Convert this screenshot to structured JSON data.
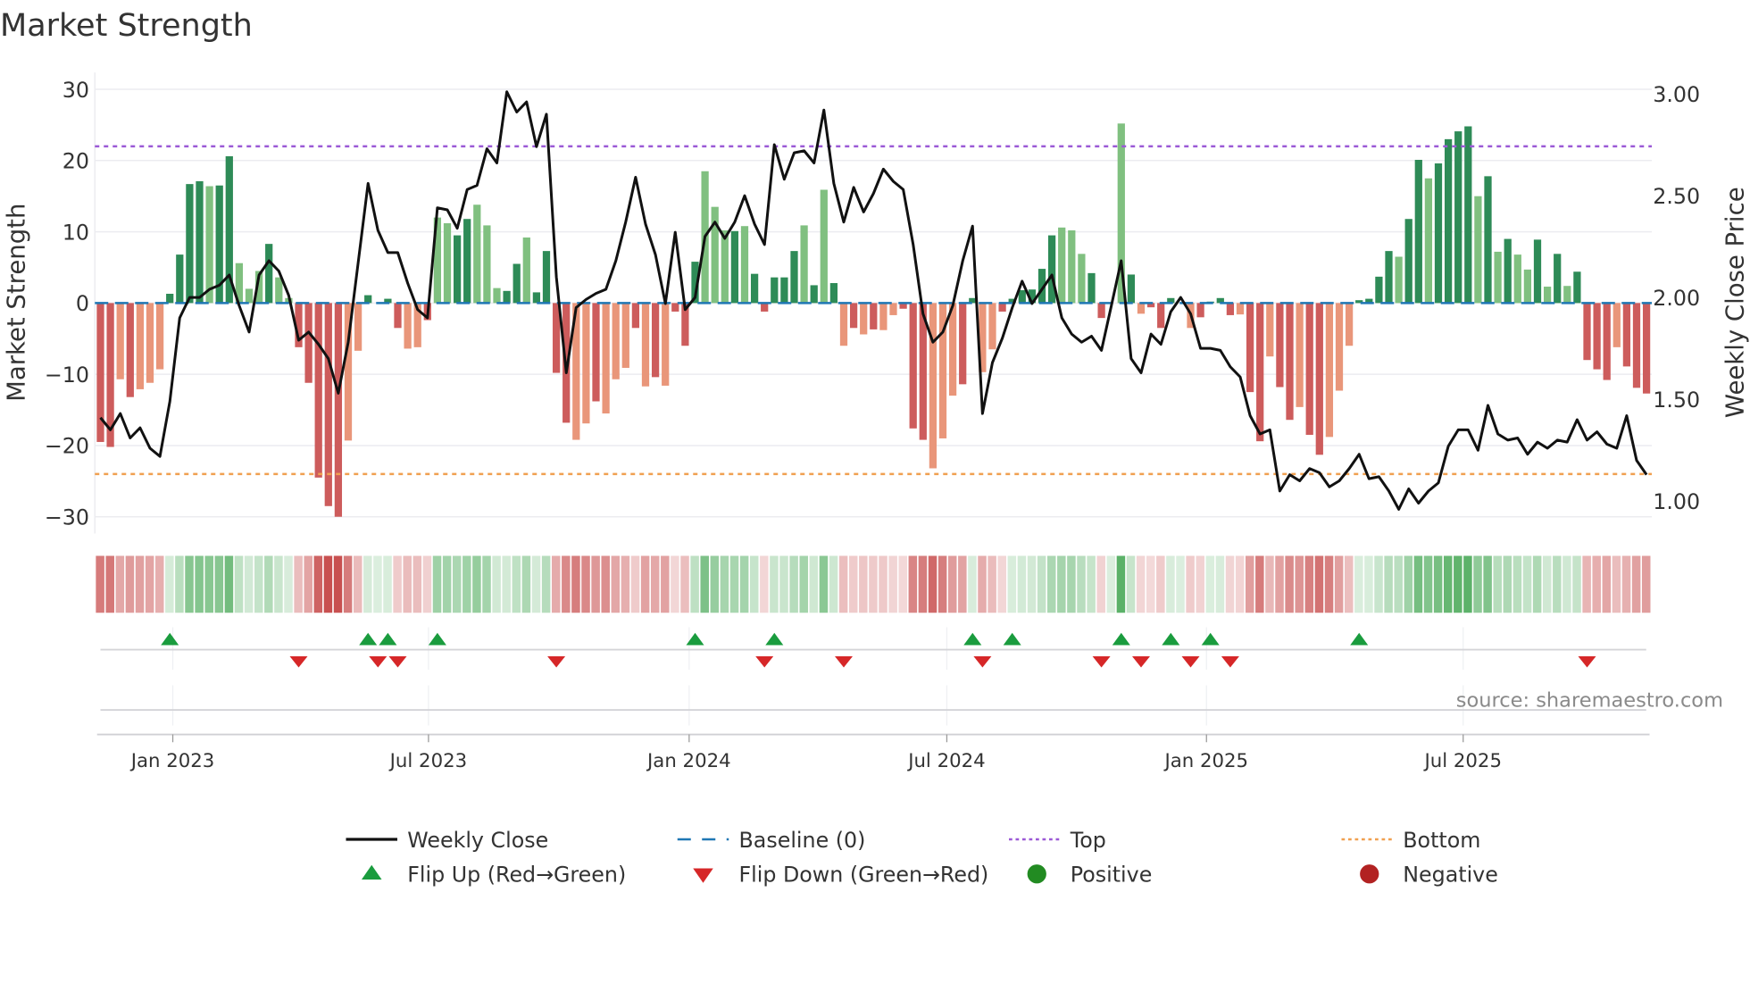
{
  "chart_data": {
    "type": "bar",
    "title": "Market Strength",
    "ylabel": "Market Strength",
    "y2label": "Weekly Close Price",
    "ylim": [
      -33,
      33
    ],
    "y2lim": [
      0.985,
      3.09
    ],
    "yticks": [
      30,
      20,
      10,
      0,
      -10,
      -20,
      -30
    ],
    "ytick_labels": [
      "30",
      "20",
      "10",
      "0",
      "−10",
      "−20",
      "−30"
    ],
    "y2ticks": [
      3.0,
      2.5,
      2.0,
      1.5,
      1.0
    ],
    "y2tick_labels": [
      "3.00",
      "2.50",
      "2.00",
      "1.50",
      "1.00"
    ],
    "xticks": [
      {
        "label": "Jan 2023",
        "week": 7.3
      },
      {
        "label": "Jul 2023",
        "week": 33.1
      },
      {
        "label": "Jan 2024",
        "week": 59.4
      },
      {
        "label": "Jul 2024",
        "week": 85.4
      },
      {
        "label": "Jan 2025",
        "week": 111.6
      },
      {
        "label": "Jul 2025",
        "week": 137.5
      }
    ],
    "top_level": 22,
    "bottom_level": -24,
    "strength": [
      -19.5,
      -20.2,
      -10.7,
      -13.2,
      -12.1,
      -11.2,
      -9.3,
      1.3,
      6.8,
      16.7,
      17.1,
      16.4,
      16.5,
      20.6,
      5.6,
      2,
      4.5,
      8.3,
      3.6,
      0.7,
      -6.2,
      -11.2,
      -24.5,
      -28.5,
      -30,
      -19.3,
      -6.7,
      1.1,
      0,
      0.6,
      -3.5,
      -6.4,
      -6.2,
      -2.4,
      12,
      11.2,
      9.5,
      11.8,
      13.8,
      10.9,
      2.1,
      1.7,
      5.5,
      9.2,
      1.5,
      7.3,
      -9.8,
      -16.8,
      -19.2,
      -16.9,
      -13.8,
      -15.5,
      -10.7,
      -9.1,
      -3.5,
      -11.7,
      -10.4,
      -11.6,
      -1.2,
      -6,
      5.8,
      18.5,
      13.5,
      10.2,
      10.1,
      10.8,
      4.1,
      -1.2,
      3.6,
      3.6,
      7.3,
      10.9,
      2.5,
      15.9,
      2.8,
      -6,
      -3.5,
      -4.4,
      -3.7,
      -3.8,
      -1.7,
      -0.8,
      -17.6,
      -19.2,
      -23.2,
      -19,
      -13,
      -11.4,
      0.7,
      -9.7,
      -6.5,
      -1.2,
      0.6,
      1.8,
      1.9,
      4.8,
      9.5,
      10.6,
      10.2,
      6.9,
      4.2,
      -2.1,
      0,
      25.2,
      4,
      -1.5,
      -0.6,
      -3.5,
      0.7,
      0,
      -3.5,
      -2,
      0.2,
      0.7,
      -1.7,
      -1.6,
      -12.5,
      -19.4,
      -7.5,
      -11.8,
      -16.4,
      -14.6,
      -18.5,
      -21.3,
      -18.8,
      -12.3,
      -6,
      0.4,
      0.6,
      3.7,
      7.3,
      6.5,
      11.8,
      20.1,
      17.5,
      19.6,
      23,
      24.1,
      24.8,
      15,
      17.8,
      7.2,
      9,
      6.8,
      4.7,
      8.9,
      2.3,
      6.9,
      2.4,
      4.4,
      -8,
      -9.3,
      -10.8,
      -6.2,
      -8.9,
      -11.9,
      -12.7
    ],
    "shade": "DDLDLLLDDDDLDDLLLDLLDDDDDLLDDDDLLDLLDDLLLDDLDDDDLLDLLLDLDLDDDLLLDLDDDDDLDLDLDLDLLDDDLLLDDLLDDDDDDLLLDDDLDLDDDDLDDDDLDDLDDLDDLLLDDDDLDDLDDDDLDLDLLDLDLDDDDLDDD",
    "weekly_close": [
      1.41,
      1.35,
      1.43,
      1.31,
      1.36,
      1.26,
      1.22,
      1.49,
      1.9,
      2.0,
      2.0,
      2.04,
      2.06,
      2.11,
      1.96,
      1.83,
      2.11,
      2.18,
      2.13,
      2.01,
      1.79,
      1.83,
      1.77,
      1.7,
      1.53,
      1.78,
      2.17,
      2.56,
      2.33,
      2.22,
      2.22,
      2.07,
      1.94,
      1.9,
      2.44,
      2.43,
      2.34,
      2.53,
      2.55,
      2.73,
      2.66,
      3.01,
      2.91,
      2.96,
      2.74,
      2.9,
      2.1,
      1.63,
      1.95,
      1.99,
      2.02,
      2.04,
      2.18,
      2.37,
      2.59,
      2.36,
      2.21,
      1.97,
      2.32,
      1.94,
      2.0,
      2.3,
      2.37,
      2.29,
      2.37,
      2.5,
      2.36,
      2.26,
      2.75,
      2.58,
      2.71,
      2.72,
      2.66,
      2.92,
      2.56,
      2.37,
      2.54,
      2.42,
      2.51,
      2.63,
      2.57,
      2.53,
      2.26,
      1.92,
      1.78,
      1.83,
      1.96,
      2.18,
      2.35,
      1.43,
      1.68,
      1.8,
      1.95,
      2.08,
      1.97,
      2.04,
      2.11,
      1.9,
      1.82,
      1.78,
      1.81,
      1.74,
      1.96,
      2.18,
      1.7,
      1.63,
      1.82,
      1.77,
      1.93,
      2.0,
      1.92,
      1.75,
      1.75,
      1.74,
      1.66,
      1.61,
      1.42,
      1.33,
      1.35,
      1.05,
      1.13,
      1.1,
      1.16,
      1.14,
      1.07,
      1.1,
      1.16,
      1.23,
      1.11,
      1.12,
      1.05,
      0.96,
      1.06,
      0.99,
      1.05,
      1.09,
      1.27,
      1.35,
      1.35,
      1.25,
      1.47,
      1.33,
      1.3,
      1.31,
      1.23,
      1.29,
      1.26,
      1.3,
      1.29,
      1.4,
      1.3,
      1.34,
      1.28,
      1.26,
      1.42,
      1.2,
      1.13
    ],
    "flip_up_weeks": [
      7,
      27,
      29,
      34,
      60,
      68,
      88,
      92,
      103,
      108,
      112,
      127
    ],
    "flip_down_weeks": [
      20,
      28,
      30,
      46,
      67,
      75,
      89,
      101,
      105,
      110,
      114,
      150
    ],
    "source": "source: sharemaestro.com",
    "legend": {
      "placement": "bottom",
      "items": [
        {
          "label": "Weekly Close",
          "kind": "line"
        },
        {
          "label": "Baseline (0)",
          "kind": "dash"
        },
        {
          "label": "Top",
          "kind": "dot-top"
        },
        {
          "label": "Bottom",
          "kind": "dot-bottom"
        },
        {
          "label": "Flip Up (Red→Green)",
          "kind": "tri-up"
        },
        {
          "label": "Flip Down (Green→Red)",
          "kind": "tri-down"
        },
        {
          "label": "Positive",
          "kind": "dot-pos"
        },
        {
          "label": "Negative",
          "kind": "dot-neg"
        }
      ]
    },
    "colors": {
      "pos_dark": "#2e8b57",
      "pos_light": "#80c080",
      "neg_dark": "#cd5c5c",
      "neg_light": "#e9967a",
      "line": "#111111",
      "baseline": "#1f77b4",
      "top": "#9b59d6",
      "bottom": "#f0a050",
      "flip_up": "#1a9c3e",
      "flip_down": "#d62728",
      "positive": "#228b22",
      "negative": "#b22222"
    }
  }
}
